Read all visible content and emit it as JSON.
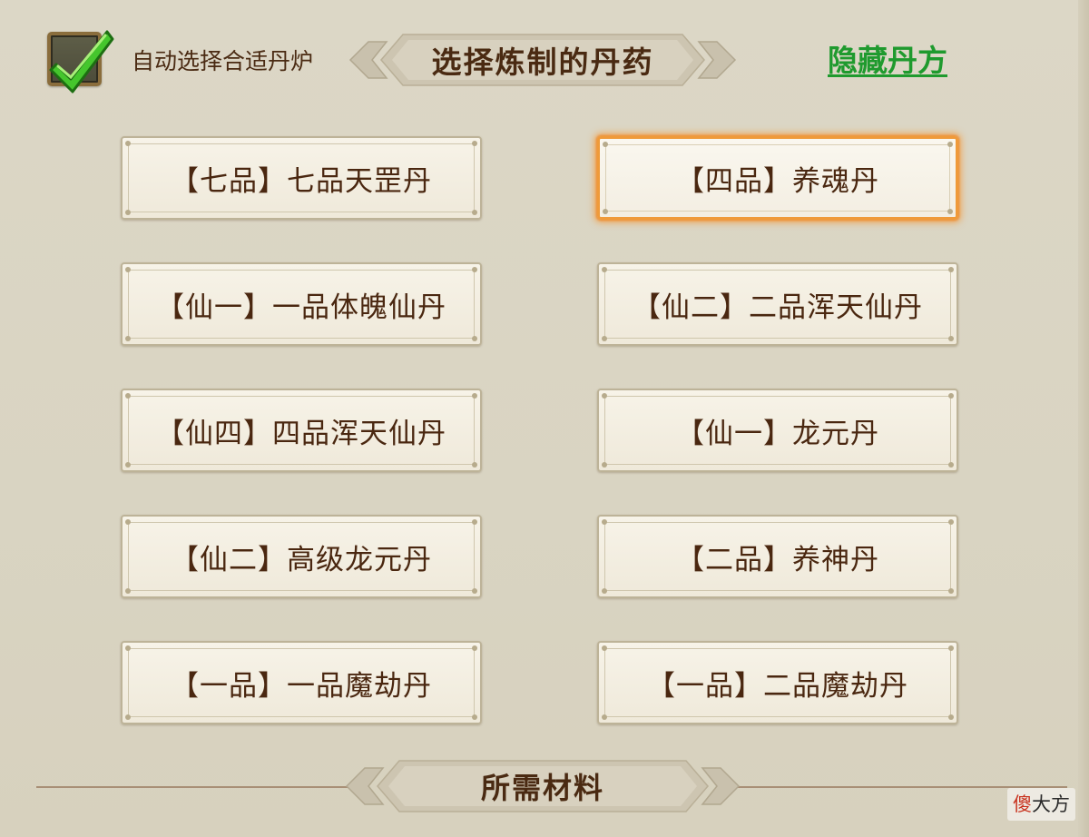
{
  "header": {
    "auto_select_label": "自动选择合适丹炉",
    "auto_select_checked": true,
    "title": "选择炼制的丹药",
    "hide_recipe_link": "隐藏丹方"
  },
  "recipes": [
    {
      "label": "【七品】七品天罡丹",
      "selected": false
    },
    {
      "label": "【四品】养魂丹",
      "selected": true
    },
    {
      "label": "【仙一】一品体魄仙丹",
      "selected": false
    },
    {
      "label": "【仙二】二品浑天仙丹",
      "selected": false
    },
    {
      "label": "【仙四】四品浑天仙丹",
      "selected": false
    },
    {
      "label": "【仙一】龙元丹",
      "selected": false
    },
    {
      "label": "【仙二】高级龙元丹",
      "selected": false
    },
    {
      "label": "【二品】养神丹",
      "selected": false
    },
    {
      "label": "【一品】一品魔劫丹",
      "selected": false
    },
    {
      "label": "【一品】二品魔劫丹",
      "selected": false
    }
  ],
  "materials_section": {
    "title": "所需材料"
  },
  "watermark": {
    "first": "傻",
    "rest": "大方"
  },
  "colors": {
    "text_brown": "#4a2710",
    "link_green": "#1f9a2e",
    "selected_glow": "#ef9a3a",
    "check_green": "#3fbf2a"
  },
  "icons": {
    "checkbox": "checkmark-icon"
  }
}
